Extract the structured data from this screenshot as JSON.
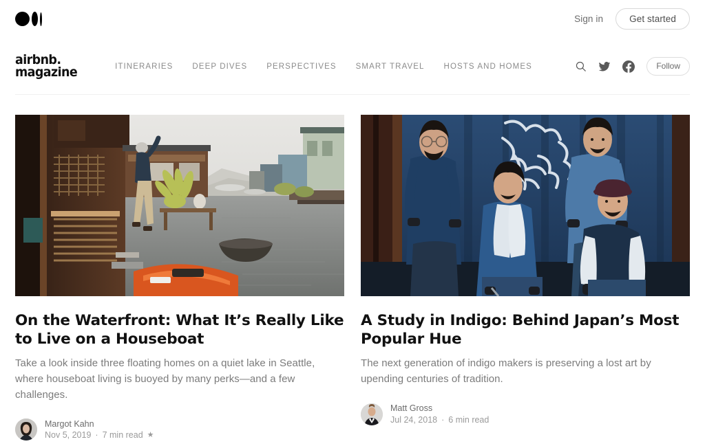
{
  "topbar": {
    "logo_icon": "medium-logo-icon",
    "signin_label": "Sign in",
    "get_started_label": "Get started"
  },
  "publication": {
    "name_line1": "airbnb.",
    "name_line2": "magazine",
    "nav_items": [
      {
        "label": "ITINERARIES"
      },
      {
        "label": "DEEP DIVES"
      },
      {
        "label": "PERSPECTIVES"
      },
      {
        "label": "SMART TRAVEL"
      },
      {
        "label": "HOSTS AND HOMES"
      }
    ],
    "actions": {
      "search_icon": "search-icon",
      "twitter_icon": "twitter-icon",
      "facebook_icon": "facebook-icon",
      "follow_label": "Follow"
    }
  },
  "articles": [
    {
      "title": "On the Waterfront: What It’s Really Like to Live on a Houseboat",
      "subtitle": "Take a look inside three floating homes on a quiet lake in Seattle, where houseboat living is buoyed by many perks—and a few challenges.",
      "author": "Margot Kahn",
      "date": "Nov 5, 2019",
      "read_time": "7 min read",
      "meta_separator": "·",
      "member_star": "★",
      "image_alt": "houseboat-dock-photo"
    },
    {
      "title": "A Study in Indigo: Behind Japan’s Most Popular Hue",
      "subtitle": "The next generation of indigo makers is preserving a lost art by upending centuries of tradition.",
      "author": "Matt Gross",
      "date": "Jul 24, 2018",
      "read_time": "6 min read",
      "meta_separator": "·",
      "member_star": "",
      "image_alt": "indigo-makers-portrait-photo"
    }
  ],
  "colors": {
    "background": "#ffffff",
    "text_primary": "#111111",
    "text_secondary": "#7b7b7b",
    "text_muted": "#9a9a9a",
    "divider": "#f0f0f0",
    "border": "#dddddd"
  }
}
